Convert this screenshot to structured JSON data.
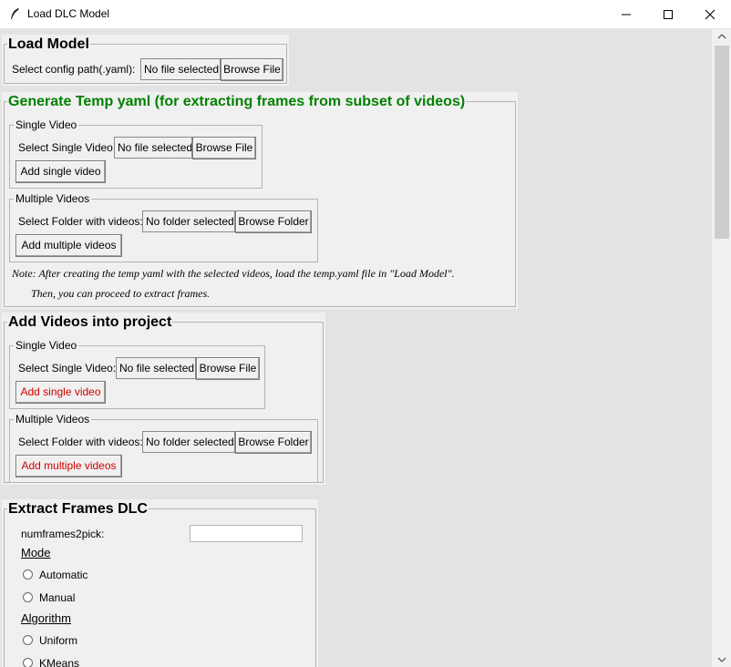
{
  "window": {
    "title": "Load DLC Model"
  },
  "load_model": {
    "title": "Load Model",
    "config_label": "Select config path(.yaml):",
    "config_value": "No file selected",
    "browse_label": "Browse File"
  },
  "temp_yaml": {
    "title": "Generate Temp yaml (for extracting frames from subset of videos)",
    "single": {
      "title": "Single Video",
      "label": "Select Single Video:",
      "value": "No file selected",
      "browse_label": "Browse File",
      "add_label": "Add single video"
    },
    "multiple": {
      "title": "Multiple Videos",
      "label": "Select Folder with videos:",
      "value": "No folder selected",
      "browse_label": "Browse Folder",
      "add_label": "Add multiple videos"
    },
    "note_line1": "Note: After creating the temp yaml with the selected videos, load the temp.yaml file in \"Load Model\".",
    "note_line2": "Then, you can proceed to extract frames."
  },
  "add_videos": {
    "title": "Add Videos into project",
    "single": {
      "title": "Single Video",
      "label": "Select Single Video:",
      "value": "No file selected",
      "browse_label": "Browse File",
      "add_label": "Add single video"
    },
    "multiple": {
      "title": "Multiple Videos",
      "label": "Select Folder with videos:",
      "value": "No folder selected",
      "browse_label": "Browse Folder",
      "add_label": "Add multiple videos"
    }
  },
  "extract_frames": {
    "title": "Extract Frames DLC",
    "numframes_label": "numframes2pick:",
    "numframes_value": "",
    "mode_heading": "Mode",
    "mode_options": [
      "Automatic",
      "Manual"
    ],
    "algorithm_heading": "Algorithm",
    "algorithm_options": [
      "Uniform",
      "KMeans"
    ]
  },
  "colors": {
    "accent_green": "#008000",
    "action_red": "#d00000"
  }
}
